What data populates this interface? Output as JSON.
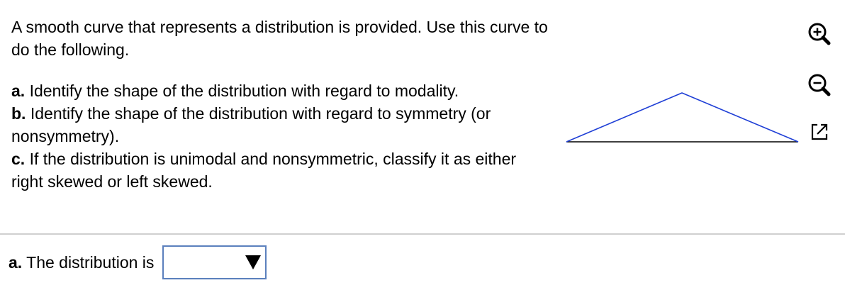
{
  "question": {
    "intro": "A smooth curve that represents a distribution is provided. Use this curve to do the following.",
    "parts": [
      {
        "letter": "a.",
        "text": " Identify the shape of the distribution with regard to modality."
      },
      {
        "letter": "b.",
        "text": " Identify the shape of the distribution with regard to symmetry (or nonsymmetry)."
      },
      {
        "letter": "c.",
        "text": " If the distribution is unimodal and nonsymmetric, classify it as either right skewed or left skewed."
      }
    ]
  },
  "toolbar": {
    "icons": [
      "zoom-in-icon",
      "zoom-out-icon",
      "popout-icon"
    ]
  },
  "figure": {
    "curve_color": "#1f3fd6",
    "baseline_color": "#000000"
  },
  "answer": {
    "letter": "a.",
    "label": " The distribution is",
    "dropdown_value": ""
  },
  "colors": {
    "divider": "#d0d0d0",
    "dropdown_border": "#5b80bd"
  }
}
